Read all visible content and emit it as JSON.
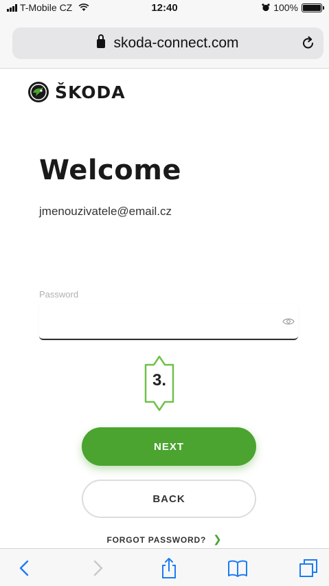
{
  "status_bar": {
    "carrier": "T-Mobile CZ",
    "time": "12:40",
    "battery": "100%",
    "battery_level": 1.0
  },
  "browser": {
    "url": "skoda-connect.com",
    "icons": [
      "lock-icon",
      "reload-icon"
    ]
  },
  "header": {
    "brand": "ŠKODA",
    "logo_icon": "skoda-arrow-logo"
  },
  "login": {
    "title": "Welcome",
    "email": "jmenouzivatele@email.cz",
    "password_label": "Password",
    "password_value": "",
    "eye_icon": "eye-icon"
  },
  "annotation": {
    "step": "3."
  },
  "buttons": {
    "next": "NEXT",
    "back": "BACK",
    "forgot": "FORGOT PASSWORD?"
  },
  "toolbar": {
    "items": [
      "back-icon",
      "forward-icon",
      "share-icon",
      "bookmarks-icon",
      "tabs-icon"
    ]
  },
  "colors": {
    "accent": "#4aa42f",
    "callout_border": "#6fc14a",
    "text": "#1a1a1a"
  }
}
